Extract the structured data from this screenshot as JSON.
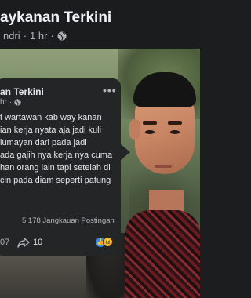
{
  "outer_post": {
    "page_name": "aykanan Terkini",
    "author": "ndri",
    "time": "1 hr",
    "separator": "·",
    "privacy_icon": "globe-icon"
  },
  "inner_post": {
    "page_name": "an Terkini",
    "time": "hr",
    "separator": "·",
    "privacy_icon": "globe-icon",
    "more_icon": "more-options-icon",
    "more_label": "•••",
    "body_lines": [
      "t wartawan kab way kanan",
      "ian kerja nyata aja jadi kuli",
      "lumayan dari pada jadi",
      "ada  gajih nya kerja nya cuma",
      "han orang lain tapi setelah di",
      "cin pada diam seperti patung"
    ],
    "reach_text": "5.178 Jangkauan Postingan",
    "comments_count": "07",
    "shares_count": "10",
    "share_icon": "share-arrow-icon",
    "reactions": [
      "like-icon",
      "haha-icon"
    ],
    "like_glyph": "👍",
    "haha_glyph": "😆"
  },
  "colors": {
    "app_background": "#1c1d1f",
    "card_background": "#242526",
    "primary_text": "#e4e6eb",
    "secondary_text": "#b0b3b8",
    "like_blue": "#2d88ff",
    "haha_yellow": "#f7b125"
  }
}
